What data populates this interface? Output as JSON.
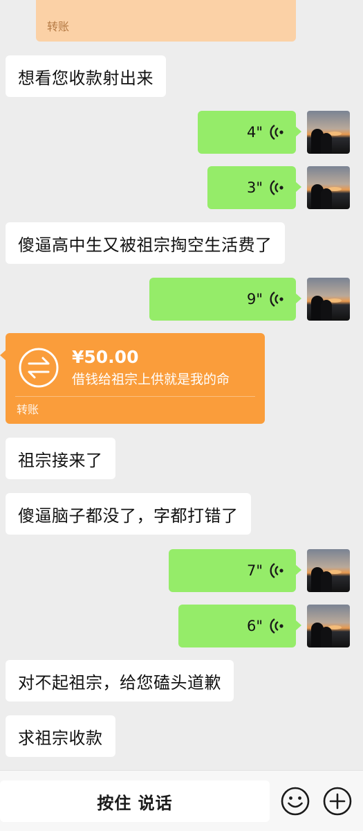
{
  "top_transfer": {
    "label": "转账"
  },
  "messages": {
    "m1": "想看您收款射出来",
    "v1": "4\"",
    "v2": "3\"",
    "m2": "傻逼高中生又被祖宗掏空生活费了",
    "v3": "9\"",
    "transfer": {
      "amount": "¥50.00",
      "note": "借钱给祖宗上供就是我的命",
      "label": "转账"
    },
    "m3": "祖宗接来了",
    "m4": "傻逼脑子都没了，字都打错了",
    "v4": "7\"",
    "v5": "6\"",
    "m5": "对不起祖宗，给您磕头道歉",
    "m6": "求祖宗收款"
  },
  "input_bar": {
    "hold_to_talk": "按住 说话"
  },
  "icons": {
    "voice": "voice-wave-icon",
    "transfer": "transfer-arrows-icon",
    "emoji": "emoji-icon",
    "more": "plus-icon"
  },
  "colors": {
    "background": "#ededed",
    "outgoing_bubble": "#95ec69",
    "incoming_bubble": "#ffffff",
    "transfer_card": "#fa9d3b",
    "transfer_card_received": "#fbd1a6"
  }
}
